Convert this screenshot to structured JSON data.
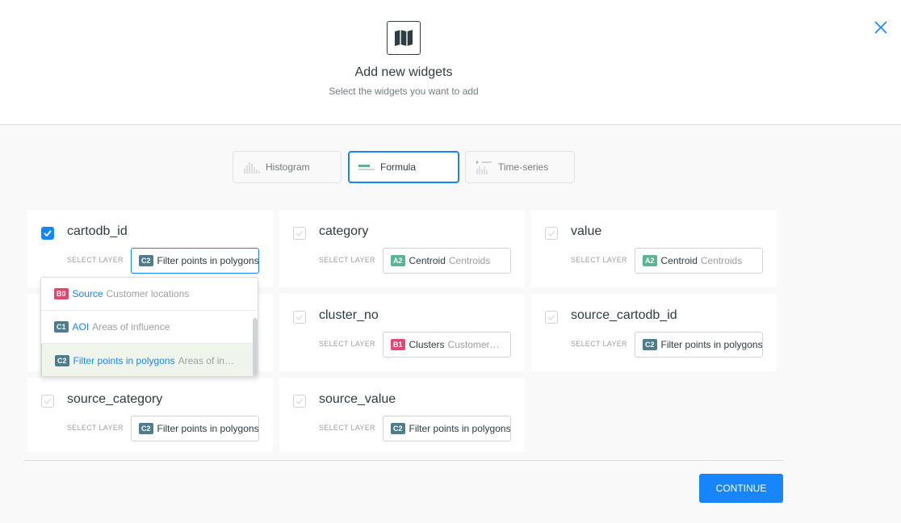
{
  "header": {
    "title": "Add new widgets",
    "subtitle": "Select the widgets you want to add",
    "icon": "map-icon",
    "close_icon": "close-icon"
  },
  "tabs": [
    {
      "label": "Histogram",
      "icon": "histogram-icon",
      "active": false
    },
    {
      "label": "Formula",
      "icon": "formula-icon",
      "active": true
    },
    {
      "label": "Time-series",
      "icon": "time-series-icon",
      "active": false
    }
  ],
  "select_layer_label": "SELECT LAYER",
  "cards": [
    {
      "column": "cartodb_id",
      "checked": true,
      "layer_badge": "C2",
      "layer_name": "Filter points in polygons",
      "layer_source": ""
    },
    {
      "column": "category",
      "checked": false,
      "layer_badge": "A2",
      "layer_name": "Centroid",
      "layer_source": "Centroids"
    },
    {
      "column": "value",
      "checked": false,
      "layer_badge": "A2",
      "layer_name": "Centroid",
      "layer_source": "Centroids"
    },
    {
      "column": "cluster_no",
      "checked": false,
      "layer_badge": "B1",
      "layer_name": "Clusters",
      "layer_source": "Customer…"
    },
    {
      "column": "source_cartodb_id",
      "checked": false,
      "layer_badge": "C2",
      "layer_name": "Filter points in polygons",
      "layer_source": ""
    },
    {
      "column": "source_category",
      "checked": false,
      "layer_badge": "C2",
      "layer_name": "Filter points in polygons",
      "layer_source": ""
    },
    {
      "column": "source_value",
      "checked": false,
      "layer_badge": "C2",
      "layer_name": "Filter points in polygons",
      "layer_source": ""
    }
  ],
  "dropdown": [
    {
      "badge": "B0",
      "name": "Source",
      "source": "Customer locations",
      "selected": false
    },
    {
      "badge": "C1",
      "name": "AOI",
      "source": "Areas of influence",
      "selected": false
    },
    {
      "badge": "C2",
      "name": "Filter points in polygons",
      "source": "Areas of in…",
      "selected": true
    }
  ],
  "continue_label": "CONTINUE",
  "colors": {
    "accent": "#1785fb",
    "badge_A": "#5bb592",
    "badge_B": "#e0486f",
    "badge_C": "#4e7c8c"
  }
}
